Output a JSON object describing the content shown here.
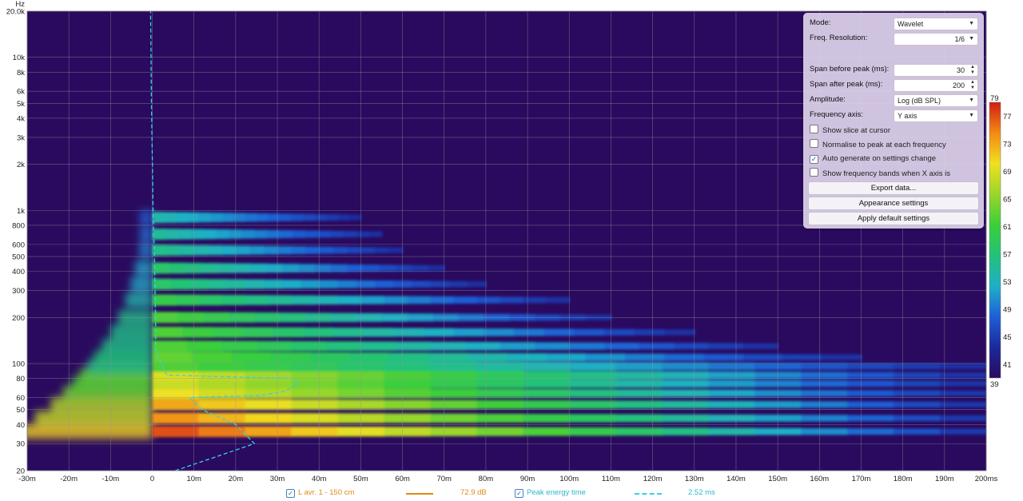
{
  "chart_data": {
    "type": "heatmap",
    "title": "",
    "x_unit_label": "",
    "y_unit_label": "Hz",
    "x_ticks": [
      "-30m",
      "-20m",
      "-10m",
      "0",
      "10m",
      "20m",
      "30m",
      "40m",
      "50m",
      "60m",
      "70m",
      "80m",
      "90m",
      "100m",
      "110m",
      "120m",
      "130m",
      "140m",
      "150m",
      "160m",
      "170m",
      "180m",
      "190m",
      "200ms"
    ],
    "x_range_ms": [
      -30,
      200
    ],
    "y_ticks": [
      {
        "v": 20000,
        "label": "20.0k"
      },
      {
        "v": 10000,
        "label": "10k"
      },
      {
        "v": 8000,
        "label": "8k"
      },
      {
        "v": 6000,
        "label": "6k"
      },
      {
        "v": 5000,
        "label": "5k"
      },
      {
        "v": 4000,
        "label": "4k"
      },
      {
        "v": 3000,
        "label": "3k"
      },
      {
        "v": 2000,
        "label": "2k"
      },
      {
        "v": 1000,
        "label": "1k"
      },
      {
        "v": 800,
        "label": "800"
      },
      {
        "v": 600,
        "label": "600"
      },
      {
        "v": 500,
        "label": "500"
      },
      {
        "v": 400,
        "label": "400"
      },
      {
        "v": 300,
        "label": "300"
      },
      {
        "v": 200,
        "label": "200"
      },
      {
        "v": 100,
        "label": "100"
      },
      {
        "v": 80,
        "label": "80"
      },
      {
        "v": 60,
        "label": "60"
      },
      {
        "v": 50,
        "label": "50"
      },
      {
        "v": 40,
        "label": "40"
      },
      {
        "v": 30,
        "label": "30"
      },
      {
        "v": 20,
        "label": "20"
      }
    ],
    "y_range_hz": [
      20,
      20000
    ],
    "y_scale": "log",
    "grid": true,
    "colorbar": {
      "min": 39,
      "max": 79,
      "ticks": [
        41,
        45,
        49,
        53,
        57,
        61,
        65,
        69,
        73,
        77
      ],
      "min_label": "39",
      "max_label": "79",
      "colors": [
        "#2a0a5e",
        "#1a2a9c",
        "#1f5fd6",
        "#1fb0c8",
        "#22c27a",
        "#3ccf3a",
        "#9bd62a",
        "#f0e020",
        "#f28a14",
        "#d21e14"
      ]
    },
    "decay_bands": [
      {
        "freq_hz": 36,
        "level_db": 77,
        "end_ms": 200
      },
      {
        "freq_hz": 44,
        "level_db": 74,
        "end_ms": 200
      },
      {
        "freq_hz": 54,
        "level_db": 73,
        "end_ms": 200
      },
      {
        "freq_hz": 64,
        "level_db": 70,
        "end_ms": 200
      },
      {
        "freq_hz": 74,
        "level_db": 68,
        "end_ms": 200
      },
      {
        "freq_hz": 84,
        "level_db": 69,
        "end_ms": 200
      },
      {
        "freq_hz": 96,
        "level_db": 62,
        "end_ms": 200
      },
      {
        "freq_hz": 110,
        "level_db": 63,
        "end_ms": 170
      },
      {
        "freq_hz": 130,
        "level_db": 62,
        "end_ms": 150
      },
      {
        "freq_hz": 160,
        "level_db": 62,
        "end_ms": 130
      },
      {
        "freq_hz": 200,
        "level_db": 62,
        "end_ms": 110
      },
      {
        "freq_hz": 260,
        "level_db": 60,
        "end_ms": 100
      },
      {
        "freq_hz": 330,
        "level_db": 58,
        "end_ms": 80
      },
      {
        "freq_hz": 420,
        "level_db": 58,
        "end_ms": 70
      },
      {
        "freq_hz": 550,
        "level_db": 56,
        "end_ms": 60
      },
      {
        "freq_hz": 700,
        "level_db": 55,
        "end_ms": 55
      },
      {
        "freq_hz": 900,
        "level_db": 54,
        "end_ms": 50
      }
    ],
    "peak_energy_time": [
      [
        20,
        5.5
      ],
      [
        25,
        16
      ],
      [
        30,
        24.5
      ],
      [
        40,
        20
      ],
      [
        50,
        12
      ],
      [
        60,
        9
      ],
      [
        62,
        26
      ],
      [
        66,
        32
      ],
      [
        74,
        35
      ],
      [
        80,
        34
      ],
      [
        84,
        3.5
      ],
      [
        95,
        2.5
      ],
      [
        120,
        0.8
      ],
      [
        200,
        0.8
      ],
      [
        500,
        0.5
      ],
      [
        1000,
        0.2
      ],
      [
        5000,
        -0.2
      ],
      [
        20000,
        -0.4
      ]
    ],
    "series": [
      {
        "name": "L avr. 1 - 150 cm",
        "value_label": "72.9 dB",
        "color": "#e08a10"
      },
      {
        "name": "Peak energy time",
        "value_label": "2.52 ms",
        "color": "#37d0e6"
      }
    ]
  },
  "panel": {
    "mode_label": "Mode:",
    "mode_value": "Wavelet",
    "freq_res_label": "Freq. Resolution:",
    "freq_res_value": "1/6",
    "span_before_label": "Span before peak (ms):",
    "span_before_value": "30",
    "span_after_label": "Span after peak (ms):",
    "span_after_value": "200",
    "amplitude_label": "Amplitude:",
    "amplitude_value": "Log (dB SPL)",
    "freq_axis_label": "Frequency axis:",
    "freq_axis_value": "Y axis",
    "checkboxes": [
      {
        "label": "Show slice at cursor",
        "checked": false
      },
      {
        "label": "Normalise to peak at each frequency",
        "checked": false
      },
      {
        "label": "Auto generate on settings change",
        "checked": true
      },
      {
        "label": "Show frequency bands when X axis is frequency",
        "checked": false
      }
    ],
    "buttons": [
      "Export data...",
      "Appearance settings",
      "Apply default settings"
    ]
  }
}
